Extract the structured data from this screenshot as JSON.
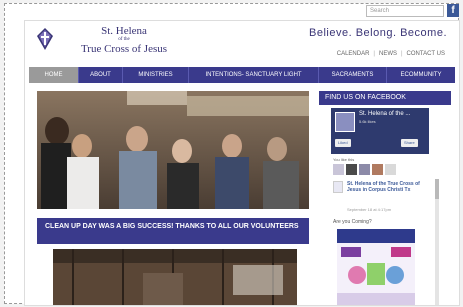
{
  "search": {
    "placeholder": "Search"
  },
  "facebook_icon": {
    "label": "f"
  },
  "logo": {
    "line1": "St. Helena",
    "line2": "of the",
    "line3": "True Cross of Jesus"
  },
  "tagline": "Believe. Belong. Become.",
  "toplinks": [
    "CALENDAR",
    "NEWS",
    "CONTACT US"
  ],
  "nav": [
    "HOME",
    "ABOUT",
    "MINISTRIES",
    "INTENTIONS- SANCTUARY LIGHT",
    "SACRAMENTS",
    "ECOMMUNITY"
  ],
  "nav_active": "HOME",
  "headline": "CLEAN UP DAY WAS A BIG SUCCESS! THANKS TO ALL OUR VOLUNTEERS",
  "sidebar": {
    "title": "FIND US ON FACEBOOK",
    "page_name": "St. Helena of the ...",
    "page_sub": "5.6k likes",
    "liked": "Liked",
    "share": "Share",
    "you_like": "You like this",
    "post_title": "St. Helena of the True Cross of Jesus in Corpus Christi Tx",
    "post_date": "September 18 at 4:17pm",
    "post_question": "Are you Coming?"
  },
  "colors": {
    "nav": "#3a3a8c",
    "brand": "#3a3576",
    "facebook": "#3b5998"
  }
}
